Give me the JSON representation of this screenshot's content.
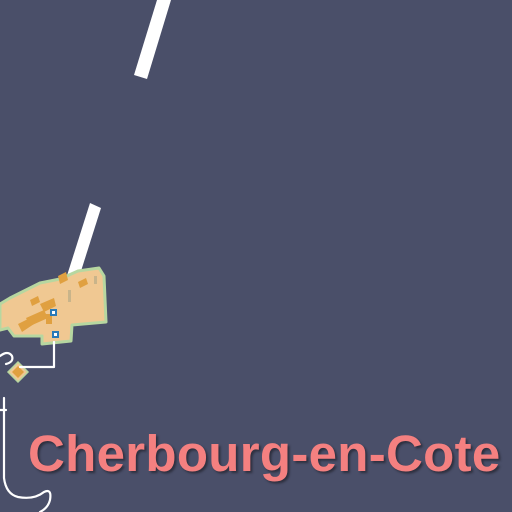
{
  "map": {
    "place_label": "Cherbourg-en-Cote",
    "colors": {
      "sea": "#4a4f69",
      "land_builtup": "#f0c892",
      "land_edge": "#b7d7a0",
      "buildings": "#e0a040",
      "roads": "#ffffff",
      "label": "#f48080",
      "poi_marker": "#2a7ab8"
    },
    "icons": [
      "poi-marker-icon",
      "poi-marker-icon"
    ]
  }
}
